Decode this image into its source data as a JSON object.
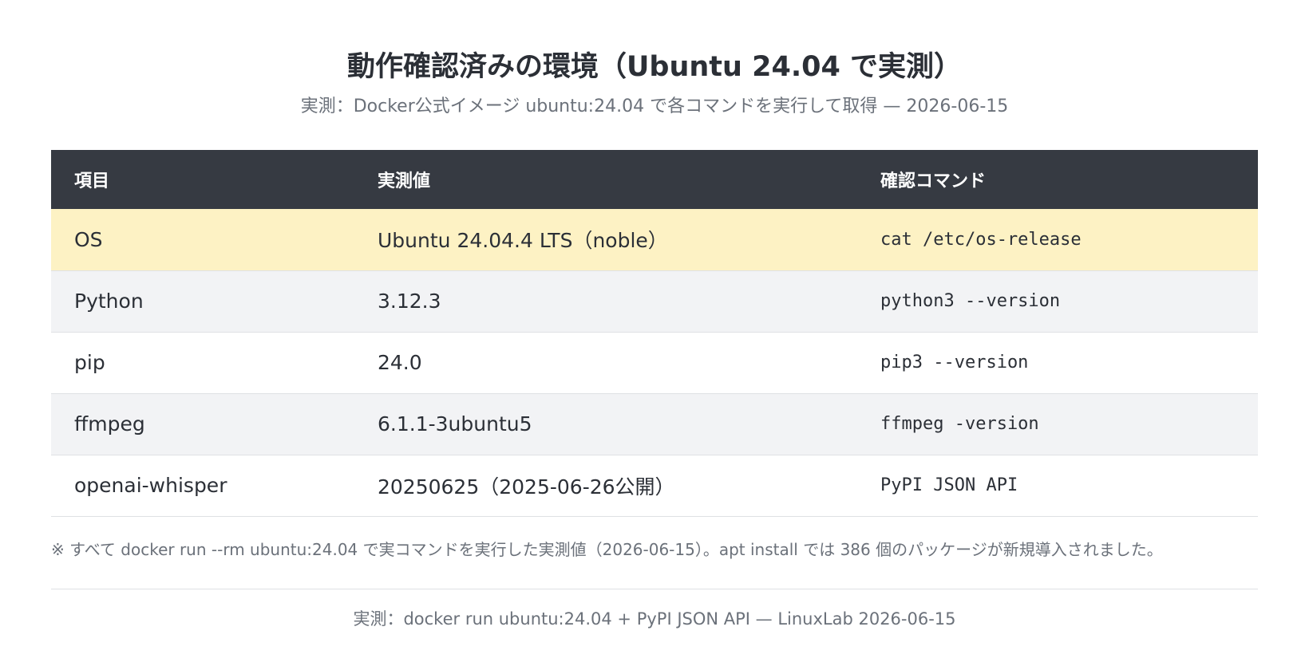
{
  "title": "動作確認済みの環境（Ubuntu 24.04 で実測）",
  "subtitle": "実測：Docker公式イメージ ubuntu:24.04 で各コマンドを実行して取得 — 2026-06-15",
  "table": {
    "headers": [
      "項目",
      "実測値",
      "確認コマンド"
    ],
    "rows": [
      {
        "item": "OS",
        "value": "Ubuntu 24.04.4 LTS（noble）",
        "command": "cat /etc/os-release",
        "highlight": true
      },
      {
        "item": "Python",
        "value": "3.12.3",
        "command": "python3 --version"
      },
      {
        "item": "pip",
        "value": "24.0",
        "command": "pip3 --version"
      },
      {
        "item": "ffmpeg",
        "value": "6.1.1-3ubuntu5",
        "command": "ffmpeg -version"
      },
      {
        "item": "openai-whisper",
        "value": "20250625（2025-06-26公開）",
        "command": "PyPI JSON API"
      }
    ]
  },
  "note": "※ すべて docker run --rm ubuntu:24.04 で実コマンドを実行した実測値（2026-06-15）。apt install では 386 個のパッケージが新規導入されました。",
  "source": "実測：docker run ubuntu:24.04 + PyPI JSON API — LinuxLab 2026-06-15",
  "colors": {
    "header_bg": "#363a42",
    "highlight_row": "#fdf2c4",
    "alt_row": "#f2f3f5",
    "text": "#2b2f36",
    "muted_text": "#6b717a"
  }
}
